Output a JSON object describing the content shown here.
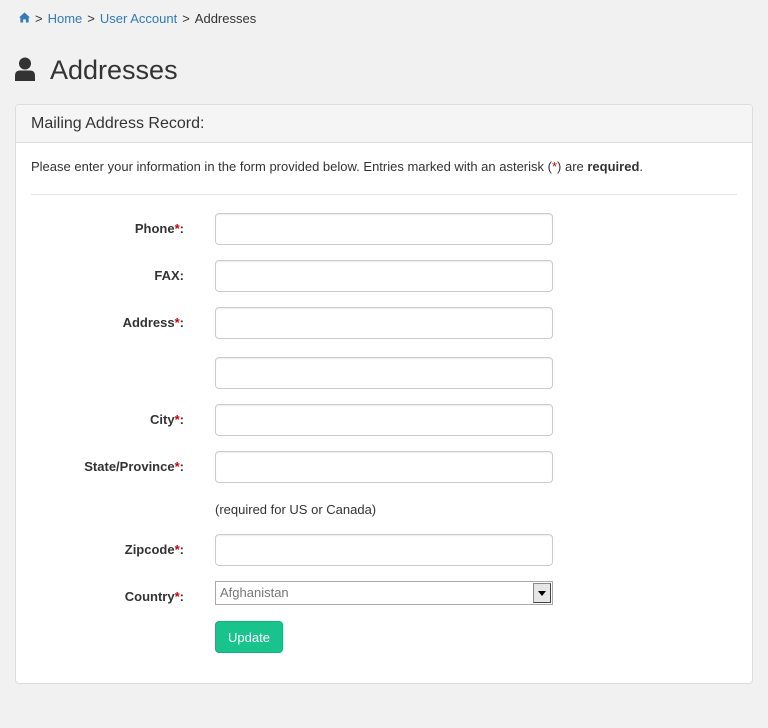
{
  "breadcrumb": {
    "separator": ">",
    "home": "Home",
    "account": "User Account",
    "current": "Addresses"
  },
  "page": {
    "title": "Addresses"
  },
  "panel": {
    "heading": "Mailing Address Record:",
    "intro_prefix": "Please enter your information in the form provided below. Entries marked with an asterisk (",
    "intro_star": "*",
    "intro_mid": ") are ",
    "intro_bold": "required",
    "intro_suffix": "."
  },
  "form": {
    "required_marker": "*",
    "colon": ":",
    "phone_label": "Phone",
    "phone_value": "",
    "fax_label": "FAX",
    "fax_value": "",
    "address_label": "Address",
    "address1_value": "",
    "address2_value": "",
    "city_label": "City",
    "city_value": "",
    "state_label": "State/Province",
    "state_value": "",
    "state_hint": "(required for US or Canada)",
    "zip_label": "Zipcode",
    "zip_value": "",
    "country_label": "Country",
    "country_selected": "Afghanistan",
    "update_label": "Update"
  },
  "colors": {
    "accent": "#337ab7",
    "required": "#cc0000",
    "button": "#18c48c"
  },
  "icons": {
    "home": "home-icon",
    "user": "user-icon",
    "select_arrow": "caret-down-icon"
  }
}
